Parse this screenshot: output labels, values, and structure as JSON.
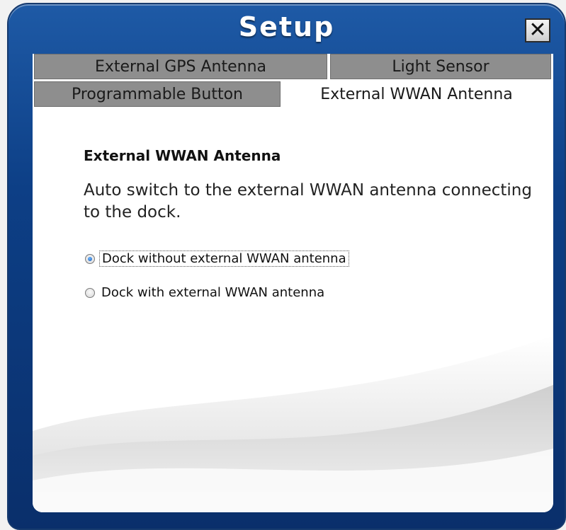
{
  "window": {
    "title": "Setup",
    "close_label": "✕"
  },
  "tabs": [
    {
      "label": "External GPS Antenna",
      "active": false
    },
    {
      "label": "Light Sensor",
      "active": false
    },
    {
      "label": "Programmable Button",
      "active": false
    },
    {
      "label": "External WWAN Antenna",
      "active": true
    }
  ],
  "section": {
    "heading": "External WWAN Antenna",
    "description": "Auto switch to the external WWAN antenna connecting to the dock."
  },
  "options": [
    {
      "label": "Dock without external WWAN antenna",
      "selected": true
    },
    {
      "label": "Dock with external WWAN antenna",
      "selected": false
    }
  ],
  "colors": {
    "frame": "#0d3f86",
    "tab_inactive": "#8e8e8e",
    "tab_active": "#ffffff",
    "radio_selected": "#1c5fb8"
  },
  "icons": {
    "close": "close-icon"
  }
}
